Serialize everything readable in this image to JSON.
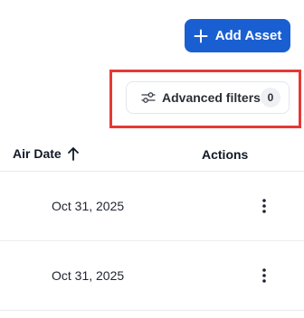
{
  "toolbar": {
    "add_asset_label": "Add Asset",
    "add_icon": "plus-icon"
  },
  "filters": {
    "advanced_filters_label": "Advanced filters",
    "advanced_filters_count": "0",
    "icon": "sliders-icon"
  },
  "table": {
    "columns": [
      {
        "label": "Air Date",
        "sort": "ascending",
        "sort_icon": "arrow-up-icon"
      },
      {
        "label": "Actions"
      }
    ],
    "rows": [
      {
        "air_date": "Oct 31, 2025",
        "actions_icon": "more-vertical-icon"
      },
      {
        "air_date": "Oct 31, 2025",
        "actions_icon": "more-vertical-icon"
      }
    ]
  },
  "colors": {
    "primary": "#1a5fd1",
    "highlight": "#e53935",
    "border": "#e3e6ea",
    "badge_bg": "#eef0f3"
  }
}
